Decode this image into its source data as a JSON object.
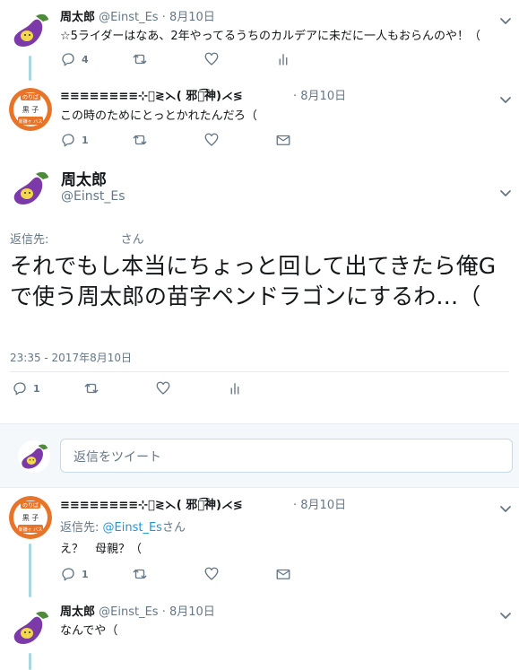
{
  "tweet1": {
    "name": "周太郎",
    "handle": "@Einst_Es",
    "dot": "·",
    "date": "8月10日",
    "text": "☆5ライダーはなあ、2年やってるうちのカルデアに未だに一人もおらんのや！（",
    "reply_count": "4"
  },
  "tweet2": {
    "name": "≡≡≡≡≡≡≡≡⊹ཽ≷⋋( 邪ཀ͡神)⋌≶",
    "dot": "·",
    "date": "8月10日",
    "text": "この時のためにとっとかれたんだろ（",
    "reply_count": "1"
  },
  "main": {
    "name": "周太郎",
    "handle": "@Einst_Es",
    "reply_to_label": "返信先:",
    "reply_to_suffix": "さん",
    "text": "それでもし本当にちょっと回して出てきたら俺Gで使う周太郎の苗字ペンドラゴンにするわ…（",
    "timestamp": "23:35 - 2017年8月10日",
    "reply_count": "1"
  },
  "reply_box": {
    "placeholder": "返信をツイート"
  },
  "tweet3": {
    "name": "≡≡≡≡≡≡≡≡⊹ཽ≷⋋( 邪ཀ͡神)⋌≶",
    "dot": "·",
    "date": "8月10日",
    "reply_to_label": "返信先:",
    "reply_to_handle": "@Einst_Es",
    "reply_to_suffix": "さん",
    "text": "え？　母親？（",
    "reply_count": "1"
  },
  "tweet4": {
    "name": "周太郎",
    "handle": "@Einst_Es",
    "dot": "·",
    "date": "8月10日",
    "text": "なんでや（"
  },
  "avatar_badge": {
    "top": "のりば",
    "middle": "黒 子",
    "bottom": "新鎌ヶ バス"
  },
  "colors": {
    "accent": "#1b95e0",
    "thread": "#a8d8dd",
    "muted": "#657786",
    "eggplant": "#7b3aa8",
    "badge_orange": "#e8742a"
  }
}
